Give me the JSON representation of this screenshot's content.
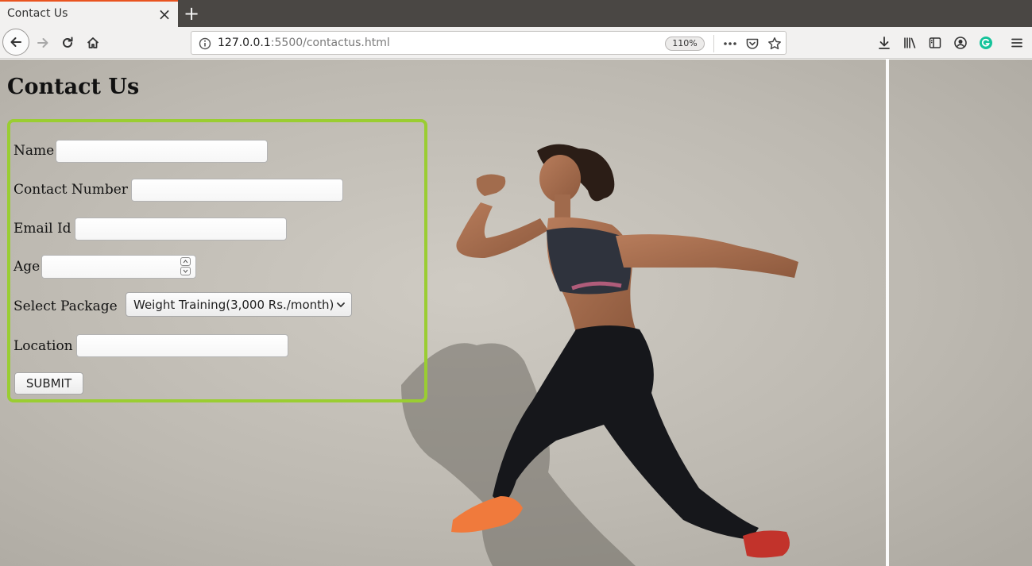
{
  "browser": {
    "tab_title": "Contact Us",
    "url_host": "127.0.0.1",
    "url_rest": ":5500/contactus.html",
    "zoom": "110%"
  },
  "page": {
    "title": "Contact Us"
  },
  "form": {
    "name_label": "Name",
    "contact_label": "Contact Number",
    "email_label": "Email Id",
    "age_label": "Age",
    "package_label": "Select Package",
    "package_selected": "Weight Training(3,000 Rs./month)",
    "location_label": "Location",
    "submit_label": "SUBMIT",
    "border_color": "#9acd32"
  },
  "icons": [
    "back-arrow-icon",
    "forward-arrow-icon",
    "reload-icon",
    "home-icon",
    "info-icon",
    "more-icon",
    "pocket-icon",
    "star-icon",
    "download-icon",
    "library-icon",
    "sidebar-icon",
    "account-icon",
    "grammarly-icon",
    "menu-icon"
  ]
}
